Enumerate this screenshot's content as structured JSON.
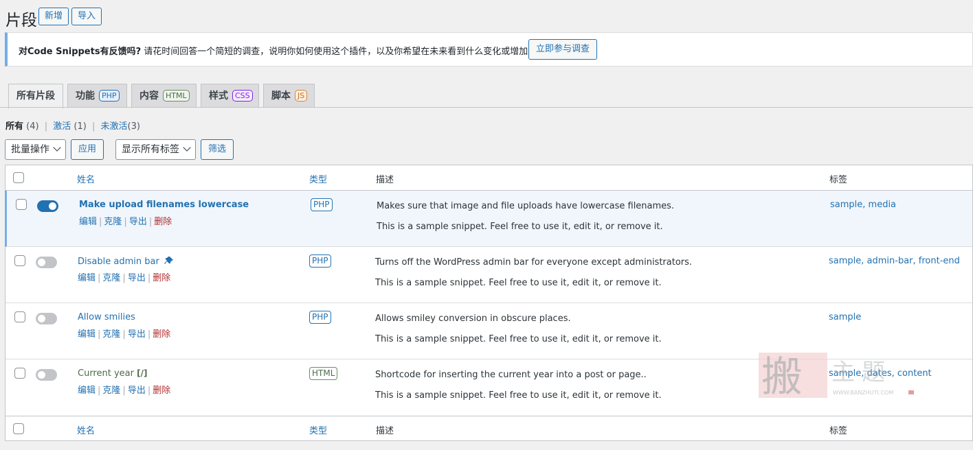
{
  "page": {
    "title": "片段",
    "add_new": "新增",
    "import": "导入"
  },
  "notice": {
    "bold": "对Code Snippets有反馈吗?",
    "text": " 请花时间回答一个简短的调查，说明你如何使用这个插件，以及你希望在未来看到什么变化或增加。",
    "button": "立即参与调查"
  },
  "tabs": [
    {
      "label": "所有片段",
      "badge": ""
    },
    {
      "label": "功能",
      "badge": "PHP"
    },
    {
      "label": "内容",
      "badge": "HTML"
    },
    {
      "label": "样式",
      "badge": "CSS"
    },
    {
      "label": "脚本",
      "badge": "JS"
    }
  ],
  "views": {
    "all": "所有",
    "all_count": "(4)",
    "active": "激活",
    "active_count": "(1)",
    "inactive": "未激活",
    "inactive_count": "(3)"
  },
  "filters": {
    "bulk": "批量操作",
    "apply": "应用",
    "tags": "显示所有标签",
    "filter": "筛选"
  },
  "columns": {
    "name": "姓名",
    "type": "类型",
    "desc": "描述",
    "tags": "标签"
  },
  "row_actions": {
    "edit": "编辑",
    "clone": "克隆",
    "export": "导出",
    "delete": "删除"
  },
  "snippets": [
    {
      "name": "Make upload filenames lowercase",
      "active": true,
      "type": "PHP",
      "desc": "Makes sure that image and file uploads have lowercase filenames.",
      "note": "This is a sample snippet. Feel free to use it, edit it, or remove it.",
      "tags": "sample, media",
      "icon": ""
    },
    {
      "name": "Disable admin bar",
      "active": false,
      "type": "PHP",
      "desc": "Turns off the WordPress admin bar for everyone except administrators.",
      "note": "This is a sample snippet. Feel free to use it, edit it, or remove it.",
      "tags": "sample, admin-bar, front-end",
      "icon": "pin-icon"
    },
    {
      "name": "Allow smilies",
      "active": false,
      "type": "PHP",
      "desc": "Allows smiley conversion in obscure places.",
      "note": "This is a sample snippet. Feel free to use it, edit it, or remove it.",
      "tags": "sample",
      "icon": ""
    },
    {
      "name": "Current year",
      "active": false,
      "type": "HTML",
      "desc": "Shortcode for inserting the current year into a post or page..",
      "note": "This is a sample snippet. Feel free to use it, edit it, or remove it.",
      "tags": "sample, dates, content",
      "icon": "shortcode-icon",
      "icon_text": "[/]"
    }
  ],
  "watermark": {
    "logo_text": "搬主题",
    "url": "WWW.BANZHUTI.COM"
  },
  "colors": {
    "accent": "#2271b1",
    "delete": "#b32d2e",
    "toggle_on": "#2271b1",
    "toggle_off": "#c3c4c7",
    "notice_border": "#72aee6"
  }
}
